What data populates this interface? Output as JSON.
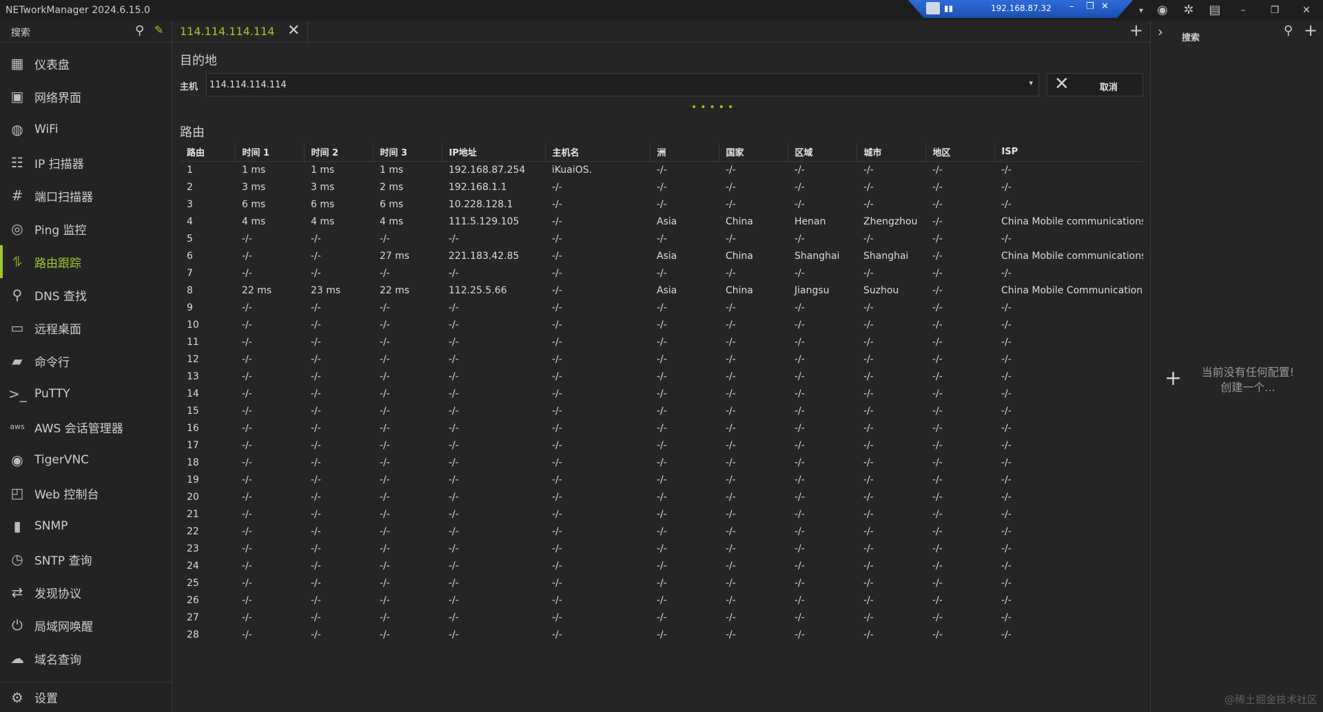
{
  "app": {
    "title": "NETworkManager 2024.6.15.0"
  },
  "rdp": {
    "ip": "192.168.87.32"
  },
  "sidebar": {
    "search_label": "搜索",
    "items": [
      {
        "label": "仪表盘",
        "icon": "dashboard-icon"
      },
      {
        "label": "网络界面",
        "icon": "network-interface-icon"
      },
      {
        "label": "WiFi",
        "icon": "wifi-icon"
      },
      {
        "label": "IP 扫描器",
        "icon": "ip-scanner-icon"
      },
      {
        "label": "端口扫描器",
        "icon": "port-scanner-icon"
      },
      {
        "label": "Ping 监控",
        "icon": "ping-monitor-icon"
      },
      {
        "label": "路由跟踪",
        "icon": "traceroute-icon",
        "active": true
      },
      {
        "label": "DNS 查找",
        "icon": "dns-lookup-icon"
      },
      {
        "label": "远程桌面",
        "icon": "remote-desktop-icon"
      },
      {
        "label": "命令行",
        "icon": "powershell-icon"
      },
      {
        "label": "PuTTY",
        "icon": "terminal-icon"
      },
      {
        "label": "AWS 会话管理器",
        "icon": "aws-icon"
      },
      {
        "label": "TigerVNC",
        "icon": "vnc-eye-icon"
      },
      {
        "label": "Web 控制台",
        "icon": "web-console-icon"
      },
      {
        "label": "SNMP",
        "icon": "snmp-icon"
      },
      {
        "label": "SNTP 查询",
        "icon": "sntp-clock-icon"
      },
      {
        "label": "发现协议",
        "icon": "discovery-arrows-icon"
      },
      {
        "label": "局域网唤醒",
        "icon": "power-icon"
      },
      {
        "label": "域名查询",
        "icon": "whois-cloud-icon"
      }
    ],
    "settings_label": "设置"
  },
  "tab": {
    "label": "114.114.114.114"
  },
  "destination": {
    "section_title": "目的地",
    "host_label": "主机",
    "host_value": "114.114.114.114",
    "cancel_label": "取消"
  },
  "route": {
    "section_title": "路由",
    "columns": [
      "路由",
      "时间 1",
      "时间 2",
      "时间 3",
      "IP地址",
      "主机名",
      "洲",
      "国家",
      "区域",
      "城市",
      "地区",
      "ISP"
    ],
    "rows": [
      [
        "1",
        "1 ms",
        "1 ms",
        "1 ms",
        "192.168.87.254",
        "iKuaiOS.",
        "-/-",
        "-/-",
        "-/-",
        "-/-",
        "-/-",
        "-/-"
      ],
      [
        "2",
        "3 ms",
        "3 ms",
        "2 ms",
        "192.168.1.1",
        "-/-",
        "-/-",
        "-/-",
        "-/-",
        "-/-",
        "-/-",
        "-/-"
      ],
      [
        "3",
        "6 ms",
        "6 ms",
        "6 ms",
        "10.228.128.1",
        "-/-",
        "-/-",
        "-/-",
        "-/-",
        "-/-",
        "-/-",
        "-/-"
      ],
      [
        "4",
        "4 ms",
        "4 ms",
        "4 ms",
        "111.5.129.105",
        "-/-",
        "Asia",
        "China",
        "Henan",
        "Zhengzhou",
        "-/-",
        "China Mobile communications c"
      ],
      [
        "5",
        "-/-",
        "-/-",
        "-/-",
        "-/-",
        "-/-",
        "-/-",
        "-/-",
        "-/-",
        "-/-",
        "-/-",
        "-/-"
      ],
      [
        "6",
        "-/-",
        "-/-",
        "27 ms",
        "221.183.42.85",
        "-/-",
        "Asia",
        "China",
        "Shanghai",
        "Shanghai",
        "-/-",
        "China Mobile communications c"
      ],
      [
        "7",
        "-/-",
        "-/-",
        "-/-",
        "-/-",
        "-/-",
        "-/-",
        "-/-",
        "-/-",
        "-/-",
        "-/-",
        "-/-"
      ],
      [
        "8",
        "22 ms",
        "23 ms",
        "22 ms",
        "112.25.5.66",
        "-/-",
        "Asia",
        "China",
        "Jiangsu",
        "Suzhou",
        "-/-",
        "China Mobile Communications ("
      ],
      [
        "9",
        "-/-",
        "-/-",
        "-/-",
        "-/-",
        "-/-",
        "-/-",
        "-/-",
        "-/-",
        "-/-",
        "-/-",
        "-/-"
      ],
      [
        "10",
        "-/-",
        "-/-",
        "-/-",
        "-/-",
        "-/-",
        "-/-",
        "-/-",
        "-/-",
        "-/-",
        "-/-",
        "-/-"
      ],
      [
        "11",
        "-/-",
        "-/-",
        "-/-",
        "-/-",
        "-/-",
        "-/-",
        "-/-",
        "-/-",
        "-/-",
        "-/-",
        "-/-"
      ],
      [
        "12",
        "-/-",
        "-/-",
        "-/-",
        "-/-",
        "-/-",
        "-/-",
        "-/-",
        "-/-",
        "-/-",
        "-/-",
        "-/-"
      ],
      [
        "13",
        "-/-",
        "-/-",
        "-/-",
        "-/-",
        "-/-",
        "-/-",
        "-/-",
        "-/-",
        "-/-",
        "-/-",
        "-/-"
      ],
      [
        "14",
        "-/-",
        "-/-",
        "-/-",
        "-/-",
        "-/-",
        "-/-",
        "-/-",
        "-/-",
        "-/-",
        "-/-",
        "-/-"
      ],
      [
        "15",
        "-/-",
        "-/-",
        "-/-",
        "-/-",
        "-/-",
        "-/-",
        "-/-",
        "-/-",
        "-/-",
        "-/-",
        "-/-"
      ],
      [
        "16",
        "-/-",
        "-/-",
        "-/-",
        "-/-",
        "-/-",
        "-/-",
        "-/-",
        "-/-",
        "-/-",
        "-/-",
        "-/-"
      ],
      [
        "17",
        "-/-",
        "-/-",
        "-/-",
        "-/-",
        "-/-",
        "-/-",
        "-/-",
        "-/-",
        "-/-",
        "-/-",
        "-/-"
      ],
      [
        "18",
        "-/-",
        "-/-",
        "-/-",
        "-/-",
        "-/-",
        "-/-",
        "-/-",
        "-/-",
        "-/-",
        "-/-",
        "-/-"
      ],
      [
        "19",
        "-/-",
        "-/-",
        "-/-",
        "-/-",
        "-/-",
        "-/-",
        "-/-",
        "-/-",
        "-/-",
        "-/-",
        "-/-"
      ],
      [
        "20",
        "-/-",
        "-/-",
        "-/-",
        "-/-",
        "-/-",
        "-/-",
        "-/-",
        "-/-",
        "-/-",
        "-/-",
        "-/-"
      ],
      [
        "21",
        "-/-",
        "-/-",
        "-/-",
        "-/-",
        "-/-",
        "-/-",
        "-/-",
        "-/-",
        "-/-",
        "-/-",
        "-/-"
      ],
      [
        "22",
        "-/-",
        "-/-",
        "-/-",
        "-/-",
        "-/-",
        "-/-",
        "-/-",
        "-/-",
        "-/-",
        "-/-",
        "-/-"
      ],
      [
        "23",
        "-/-",
        "-/-",
        "-/-",
        "-/-",
        "-/-",
        "-/-",
        "-/-",
        "-/-",
        "-/-",
        "-/-",
        "-/-"
      ],
      [
        "24",
        "-/-",
        "-/-",
        "-/-",
        "-/-",
        "-/-",
        "-/-",
        "-/-",
        "-/-",
        "-/-",
        "-/-",
        "-/-"
      ],
      [
        "25",
        "-/-",
        "-/-",
        "-/-",
        "-/-",
        "-/-",
        "-/-",
        "-/-",
        "-/-",
        "-/-",
        "-/-",
        "-/-"
      ],
      [
        "26",
        "-/-",
        "-/-",
        "-/-",
        "-/-",
        "-/-",
        "-/-",
        "-/-",
        "-/-",
        "-/-",
        "-/-",
        "-/-"
      ],
      [
        "27",
        "-/-",
        "-/-",
        "-/-",
        "-/-",
        "-/-",
        "-/-",
        "-/-",
        "-/-",
        "-/-",
        "-/-",
        "-/-"
      ],
      [
        "28",
        "-/-",
        "-/-",
        "-/-",
        "-/-",
        "-/-",
        "-/-",
        "-/-",
        "-/-",
        "-/-",
        "-/-",
        "-/-"
      ]
    ]
  },
  "profiles": {
    "search_label": "搜索",
    "empty_line1": "当前没有任何配置!",
    "empty_line2": "创建一个..."
  },
  "watermark": "@稀土掘金技术社区",
  "colors": {
    "accent": "#9ec72c",
    "background": "#252525",
    "rdp_bar": "#2f6bd8"
  }
}
